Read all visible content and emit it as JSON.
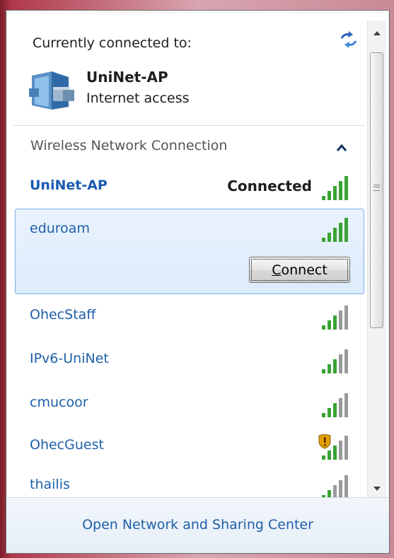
{
  "panel": {
    "connected_header": "Currently connected to:",
    "current": {
      "name": "UniNet-AP",
      "status": "Internet access"
    },
    "group": {
      "label": "Wireless Network Connection"
    },
    "networks": [
      {
        "name": "UniNet-AP",
        "state": "Connected",
        "signal_bars": 5,
        "secured": true
      },
      {
        "name": "eduroam",
        "state": "",
        "signal_bars": 5,
        "secured": true,
        "expanded": true,
        "action": "Connect"
      },
      {
        "name": "OhecStaff",
        "state": "",
        "signal_bars": 3,
        "secured": true
      },
      {
        "name": "IPv6-UniNet",
        "state": "",
        "signal_bars": 3,
        "secured": true
      },
      {
        "name": "cmucoor",
        "state": "",
        "signal_bars": 3,
        "secured": true
      },
      {
        "name": "OhecGuest",
        "state": "",
        "signal_bars": 3,
        "secured": false,
        "warning_shield": true
      },
      {
        "name": "thailis",
        "state": "",
        "signal_bars": 2,
        "secured": true
      }
    ],
    "connect_button": {
      "accel": "C",
      "rest": "onnect"
    },
    "footer_link": "Open Network and Sharing Center"
  },
  "icons": {
    "refresh": "refresh-arrows-icon",
    "network": "network-computer-icon",
    "collapse": "chevron-up-icon",
    "signal": "signal-strength-icon",
    "shield": "warning-shield-icon"
  },
  "colors": {
    "link_blue": "#1f5fa8",
    "signal_green": "#3aa335",
    "signal_gray": "#9a9a9a",
    "selection_bg": "#dcebfb",
    "selection_border": "#7eb0e3"
  }
}
